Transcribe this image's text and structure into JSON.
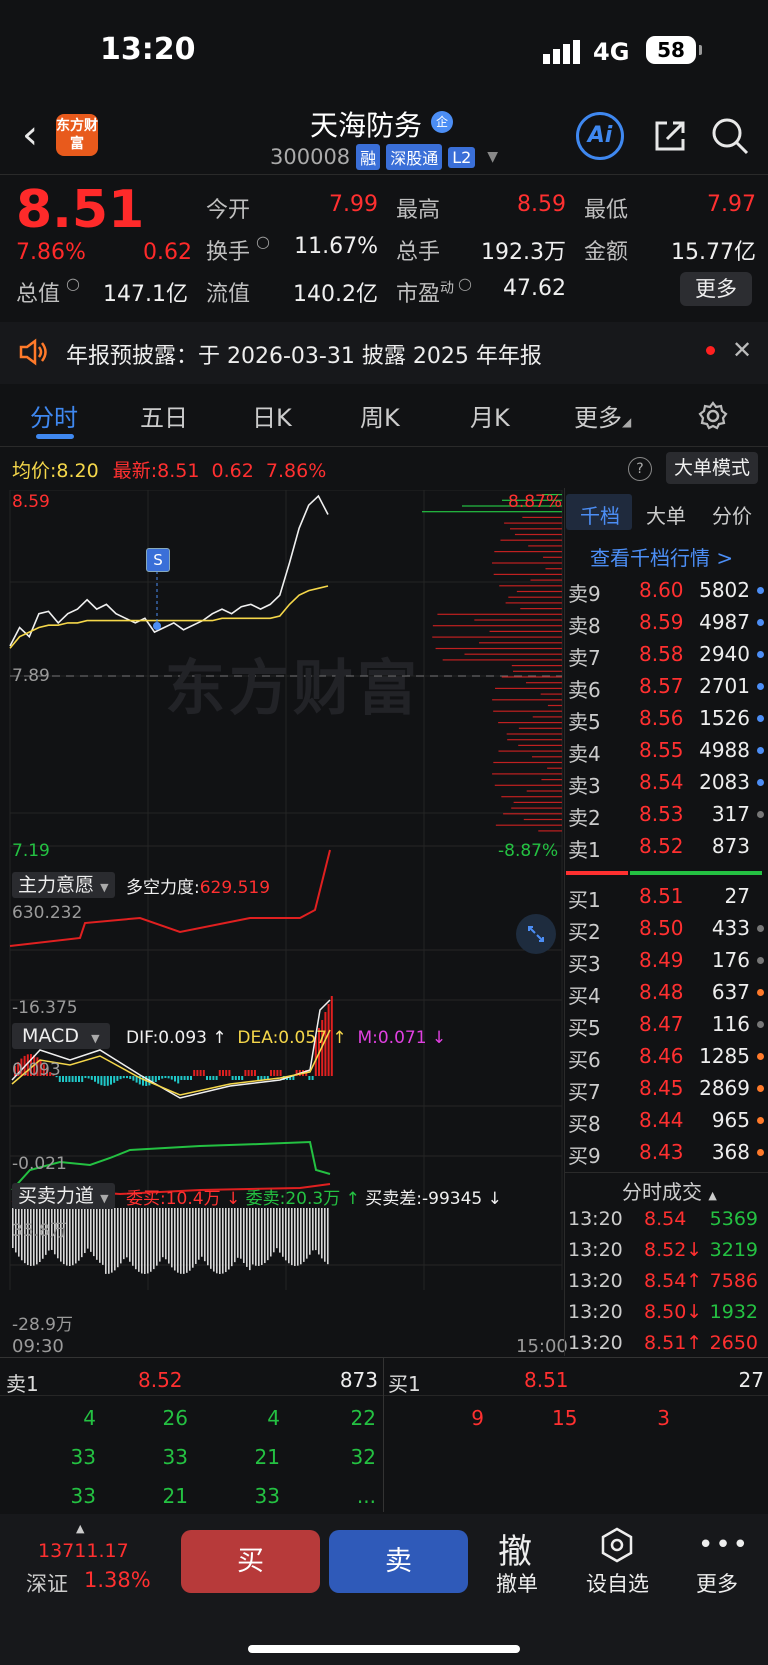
{
  "status": {
    "time": "13:20",
    "network": "4G",
    "battery": "58"
  },
  "header": {
    "logo_text": "东方财富",
    "stock_name": "天海防务",
    "name_badge": "企",
    "code": "300008",
    "tags": [
      "融",
      "深股通",
      "L2"
    ],
    "ai_label": "Ai"
  },
  "quote": {
    "price": "8.51",
    "pct": "7.86%",
    "chg": "0.62",
    "fields": [
      {
        "label": "今开",
        "value": "7.99",
        "color": "#ff3030"
      },
      {
        "label": "最高",
        "value": "8.59",
        "color": "#ff3030"
      },
      {
        "label": "最低",
        "value": "7.97",
        "color": "#ff3030"
      },
      {
        "label": "换手",
        "value": "11.67%",
        "color": "#eeeeee"
      },
      {
        "label": "总手",
        "value": "192.3万",
        "color": "#eeeeee"
      },
      {
        "label": "金额",
        "value": "15.77亿",
        "color": "#eeeeee"
      },
      {
        "label": "总值",
        "value": "147.1亿",
        "color": "#eeeeee"
      },
      {
        "label": "流值",
        "value": "140.2亿",
        "color": "#eeeeee"
      },
      {
        "label": "市盈",
        "sup": "动",
        "value": "47.62",
        "color": "#eeeeee"
      }
    ],
    "more_label": "更多"
  },
  "notice": {
    "text": "年报预披露：于 2026-03-31 披露 2025 年年报"
  },
  "tabs": [
    "分时",
    "五日",
    "日K",
    "周K",
    "月K",
    "更多"
  ],
  "info_line": {
    "avg_label": "均价:",
    "avg_value": "8.20",
    "latest_label": "最新:",
    "latest_value": "8.51",
    "latest_chg": "0.62",
    "latest_pct": "7.86%",
    "help_label": "?",
    "mode_label": "大单模式"
  },
  "chart_data": {
    "type": "line",
    "price_axis": {
      "max": "8.59",
      "max_pct": "8.87%",
      "base": "7.89",
      "min": "7.19",
      "min_pct": "-8.87%"
    },
    "time_axis": {
      "start": "09:30",
      "end": "15:00"
    },
    "watermark": "东方财富",
    "marker_label": "S",
    "series": [
      {
        "values": [
          7.94,
          8.02,
          7.98,
          8.08,
          8.09,
          8.04,
          8.08,
          8.1,
          8.14,
          8.1,
          8.12,
          8.08,
          8.06,
          8.04,
          8.06,
          8.0,
          8.02,
          8.04,
          8.01,
          8.03,
          8.05,
          8.08,
          8.1,
          8.08,
          8.11,
          8.12,
          8.1,
          8.12,
          8.16,
          8.3,
          8.45,
          8.55,
          8.59,
          8.51
        ]
      },
      {
        "values": [
          7.93,
          7.98,
          8.0,
          8.02,
          8.03,
          8.03,
          8.04,
          8.04,
          8.05,
          8.05,
          8.05,
          8.05,
          8.05,
          8.05,
          8.05,
          8.05,
          8.05,
          8.05,
          8.05,
          8.05,
          8.05,
          8.05,
          8.06,
          8.06,
          8.06,
          8.06,
          8.06,
          8.06,
          8.07,
          8.12,
          8.16,
          8.18,
          8.19,
          8.2
        ]
      }
    ]
  },
  "indicator1": {
    "name": "主力意愿",
    "label": "多空力度:",
    "value": "629.519",
    "max": "630.232",
    "min": "-16.375"
  },
  "indicator2": {
    "name": "MACD",
    "dif": "DIF:0.093 ↑",
    "dea": "DEA:0.057 ↑",
    "m": "M:0.071 ↓",
    "max": "0.093",
    "min": "-0.021"
  },
  "indicator3": {
    "name": "买卖力道",
    "wm": "委买:10.4万 ↓",
    "ws": "委卖:20.3万 ↑",
    "diff": "买卖差:-99345 ↓",
    "max": "35.8万",
    "min": "-28.9万"
  },
  "orderbook": {
    "tabs": [
      "千档",
      "大单",
      "分价"
    ],
    "link": "查看千档行情 >",
    "asks": [
      {
        "label": "卖9",
        "price": "8.60",
        "vol": "5802",
        "dot": "#4c8ef5"
      },
      {
        "label": "卖8",
        "price": "8.59",
        "vol": "4987",
        "dot": "#4c8ef5"
      },
      {
        "label": "卖7",
        "price": "8.58",
        "vol": "2940",
        "dot": "#4c8ef5"
      },
      {
        "label": "卖6",
        "price": "8.57",
        "vol": "2701",
        "dot": "#4c8ef5"
      },
      {
        "label": "卖5",
        "price": "8.56",
        "vol": "1526",
        "dot": "#4c8ef5"
      },
      {
        "label": "卖4",
        "price": "8.55",
        "vol": "4988",
        "dot": "#4c8ef5"
      },
      {
        "label": "卖3",
        "price": "8.54",
        "vol": "2083",
        "dot": "#4c8ef5"
      },
      {
        "label": "卖2",
        "price": "8.53",
        "vol": "317",
        "dot": "#777777"
      },
      {
        "label": "卖1",
        "price": "8.52",
        "vol": "873",
        "dot": ""
      }
    ],
    "bids": [
      {
        "label": "买1",
        "price": "8.51",
        "vol": "27",
        "dot": ""
      },
      {
        "label": "买2",
        "price": "8.50",
        "vol": "433",
        "dot": "#777777"
      },
      {
        "label": "买3",
        "price": "8.49",
        "vol": "176",
        "dot": "#777777"
      },
      {
        "label": "买4",
        "price": "8.48",
        "vol": "637",
        "dot": "#ff7a2a"
      },
      {
        "label": "买5",
        "price": "8.47",
        "vol": "116",
        "dot": "#777777"
      },
      {
        "label": "买6",
        "price": "8.46",
        "vol": "1285",
        "dot": "#ff7a2a"
      },
      {
        "label": "买7",
        "price": "8.45",
        "vol": "2869",
        "dot": "#ff7a2a"
      },
      {
        "label": "买8",
        "price": "8.44",
        "vol": "965",
        "dot": "#ff7a2a"
      },
      {
        "label": "买9",
        "price": "8.43",
        "vol": "368",
        "dot": "#ff7a2a"
      }
    ],
    "trades_title": "分时成交",
    "trades": [
      {
        "time": "13:20",
        "price": "8.54",
        "vol": "5369",
        "color": "#24c142"
      },
      {
        "time": "13:20",
        "price": "8.52↓",
        "vol": "3219",
        "color": "#24c142"
      },
      {
        "time": "13:20",
        "price": "8.54↑",
        "vol": "7586",
        "color": "#ff3030"
      },
      {
        "time": "13:20",
        "price": "8.50↓",
        "vol": "1932",
        "color": "#24c142"
      },
      {
        "time": "13:20",
        "price": "8.51↑",
        "vol": "2650",
        "color": "#ff3030"
      }
    ]
  },
  "level_detail": {
    "sell": {
      "label": "卖1",
      "price": "8.52",
      "vol": "873",
      "queue": [
        [
          "4",
          "26",
          "4",
          "22"
        ],
        [
          "33",
          "33",
          "21",
          "32"
        ],
        [
          "33",
          "21",
          "33",
          "..."
        ]
      ]
    },
    "buy": {
      "label": "买1",
      "price": "8.51",
      "vol": "27",
      "queue": [
        [
          "9",
          "15",
          "3"
        ]
      ]
    }
  },
  "bottom_bar": {
    "index_value": "13711.17",
    "index_name": "深证",
    "index_pct": "1.38%",
    "buy": "买",
    "sell": "卖",
    "cancel_icon": "撤",
    "cancel": "撤单",
    "watch": "设自选",
    "more": "更多"
  }
}
